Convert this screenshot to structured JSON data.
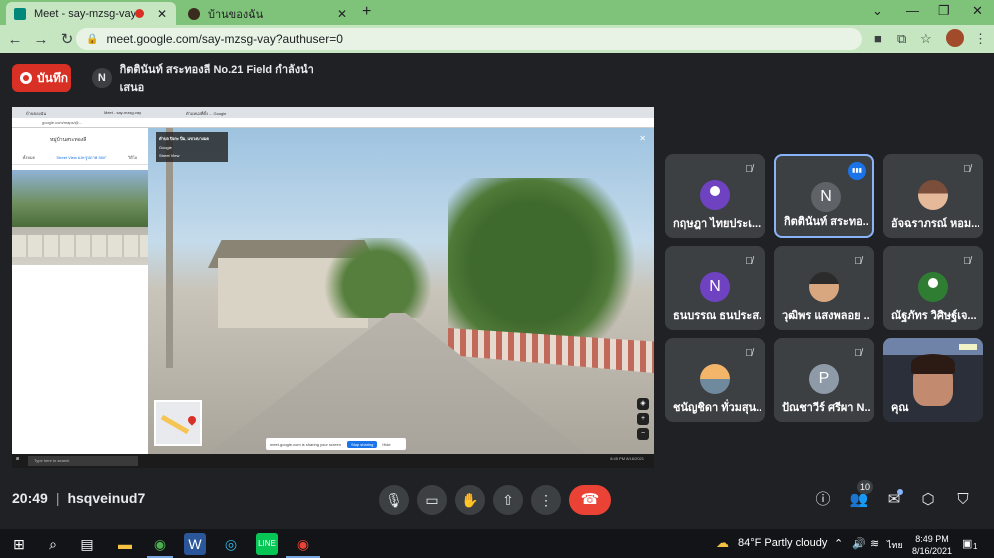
{
  "browser": {
    "tabs": [
      {
        "title": "Meet - say-mzsg-vay",
        "recording": true
      },
      {
        "title": "บ้านของฉัน"
      }
    ],
    "new_tab_label": "+",
    "url": "meet.google.com/say-mzsg-vay?authuser=0"
  },
  "meet": {
    "record_label": "บันทึก",
    "presenter_initial": "N",
    "presenting_text": "กิตตินันท์ สระทองลี No.21 Field กำลังนำเสนอ",
    "meeting_time": "20:49",
    "meeting_code": "hsqveinud7",
    "people_count": "10"
  },
  "shared_screen": {
    "tab1": "บ้านของฉัน",
    "tab2": "Meet - say-mzsg-vay",
    "tab3": "ตำแหน่งที่ตั้ง ... Google",
    "url": "google.com/maps/@...",
    "panel_title": "หมู่บ้านสระทองลี",
    "panel_tab1": "ทั้งหมด",
    "panel_tab2": "Street View และรูปภาพ 360°",
    "panel_tab3": "วิดีโอ",
    "card_title": "ตำบล ปิงกะ ปิ่ม, แขวงบางมด",
    "card_sub": "Google",
    "card_label": "Street View",
    "share_notice": "meet.google.com is sharing your screen",
    "stop_label": "Stop sharing",
    "hide_label": "Hide",
    "taskbar_search": "Type here to search",
    "mini_clock": "8:45 PM 8/16/2021"
  },
  "participants": [
    {
      "name": "กฤษฎา ไทยประเ...",
      "initial": "",
      "kind": "profile",
      "color": "#6f42c1",
      "muted": true
    },
    {
      "name": "กิตตินันท์ สระทอ...",
      "initial": "N",
      "kind": "letter",
      "color": "#5f6368",
      "speaking": true
    },
    {
      "name": "อัจฉราภรณ์ หอม...",
      "initial": "",
      "kind": "photo",
      "muted": true
    },
    {
      "name": "ธนบรรณ ธนประส...",
      "initial": "N",
      "kind": "letter",
      "color": "#6f42c1",
      "muted": true
    },
    {
      "name": "วุฒิพร แสงพลอย ...",
      "initial": "",
      "kind": "photo2",
      "muted": true
    },
    {
      "name": "ณัฐภัทร วิศิษฐ์เจ...",
      "initial": "",
      "kind": "profile",
      "color": "#2e7d32",
      "muted": true
    },
    {
      "name": "ชนัญชิดา ทั่วมสุน...",
      "initial": "",
      "kind": "sunset",
      "muted": true
    },
    {
      "name": "ปัณชาวีร์ ศรีผา N...",
      "initial": "P",
      "kind": "letter",
      "color": "#8e9aa7",
      "muted": true
    },
    {
      "name": "คุณ",
      "initial": "",
      "kind": "video"
    }
  ],
  "taskbar": {
    "weather": "84°F  Partly cloudy",
    "lang": "ไทย",
    "time": "8:49 PM",
    "date": "8/16/2021",
    "notif_count": "1"
  },
  "icons": {
    "mic": "mic-icon",
    "camera": "camera-icon",
    "hand": "raise-hand-icon",
    "present": "present-icon",
    "more": "more-icon",
    "hangup": "hangup-icon",
    "info": "info-icon",
    "people": "people-icon",
    "chat": "chat-icon",
    "activities": "activities-icon",
    "host": "host-controls-icon"
  }
}
